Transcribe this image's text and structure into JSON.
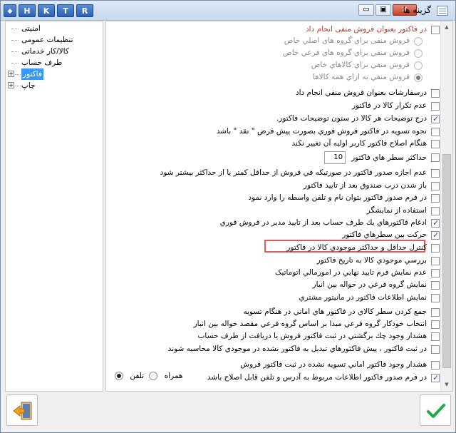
{
  "window": {
    "title": "گزینه ها",
    "hotkeys": [
      "H",
      "K",
      "T",
      "R"
    ],
    "menu_glyph": "◆",
    "controls": {
      "minimize": "▭",
      "restore": "▣",
      "close": "✕"
    }
  },
  "tree": {
    "items": [
      {
        "label": "امنیتی",
        "expandable": false,
        "selected": false
      },
      {
        "label": "تنظیمات عمومی",
        "expandable": false,
        "selected": false
      },
      {
        "label": "کالا/کار خدماتی",
        "expandable": false,
        "selected": false
      },
      {
        "label": "طرف حساب",
        "expandable": false,
        "selected": false
      },
      {
        "label": "فاکتور",
        "expandable": true,
        "selected": true
      },
      {
        "label": "چاپ",
        "expandable": true,
        "selected": false
      }
    ],
    "expand_glyph": "+"
  },
  "options": [
    {
      "type": "checkbox",
      "checked": false,
      "label": "در فاکتور بعنوان فروش منفی انجام داد",
      "red": true,
      "disabled": false,
      "sub": false
    },
    {
      "type": "radio",
      "checked": false,
      "label": "فروش منفی براي گروه هاي اصلي خاص",
      "disabled": true,
      "sub": true
    },
    {
      "type": "radio",
      "checked": false,
      "label": "فروش منفي براي گروه هاي فرعي خاص",
      "disabled": true,
      "sub": true
    },
    {
      "type": "radio",
      "checked": false,
      "label": "فروش منفي براي کالاهاي خاص",
      "disabled": true,
      "sub": true
    },
    {
      "type": "radio",
      "checked": true,
      "label": "فروش منفي به ازاي همه کالاها",
      "disabled": true,
      "sub": true
    },
    {
      "type": "checkbox",
      "checked": false,
      "label": "درسفارشات  بعنوان فروش منفي انجام داد",
      "disabled": false,
      "sub": false
    },
    {
      "type": "checkbox",
      "checked": false,
      "label": "عدم تکرار کالا در فاکتور",
      "disabled": false,
      "sub": false
    },
    {
      "type": "checkbox",
      "checked": true,
      "label": "درج توضيحات هر کالا در ستون توضيحات فاکتور.",
      "disabled": false,
      "sub": false
    },
    {
      "type": "checkbox",
      "checked": false,
      "label": "نحوه تسويه در فاکتور فروش فوري بصورت پيش فرض \" نقد \" باشد",
      "disabled": false,
      "sub": false
    },
    {
      "type": "checkbox",
      "checked": false,
      "label": "هنگام اصلاح فاکتور کاربر اوليه آن تغيير نکند",
      "disabled": false,
      "sub": false
    },
    {
      "type": "checkbox",
      "checked": false,
      "label": "حداکثر سطر هاي فاکتور",
      "disabled": false,
      "sub": false,
      "numbox": "10"
    },
    {
      "type": "checkbox",
      "checked": false,
      "label": "عدم اجازه صدور فاکتور در صورتيکه في فروش از حداقل کمتر يا از حداکثر بيشتر شود",
      "disabled": false,
      "sub": false
    },
    {
      "type": "checkbox",
      "checked": false,
      "label": "باز شدن درب صندوق بعد از تاييد فاکتور",
      "disabled": false,
      "sub": false
    },
    {
      "type": "checkbox",
      "checked": false,
      "label": "در فرم صدور فاکتور بتوان نام و تلفن واسطه را وارد نمود",
      "disabled": false,
      "sub": false
    },
    {
      "type": "checkbox",
      "checked": false,
      "label": "استفاده از نمايشگر",
      "disabled": false,
      "sub": false
    },
    {
      "type": "checkbox",
      "checked": true,
      "label": "ادغام فاکتورهاي يك طرف حساب بعد از تاييد مدير در فروش فوري",
      "disabled": false,
      "sub": false
    },
    {
      "type": "checkbox",
      "checked": true,
      "label": "حرکت بين سطرهاي فاکتور",
      "disabled": false,
      "sub": false
    },
    {
      "type": "checkbox",
      "checked": false,
      "label": "کنترل حداقل و حداکثر موجودي کالا در فاکتور",
      "disabled": false,
      "sub": false,
      "highlight": true
    },
    {
      "type": "checkbox",
      "checked": false,
      "label": "بررسي موجودي کالا به تاريخ فاکتور",
      "disabled": false,
      "sub": false
    },
    {
      "type": "checkbox",
      "checked": false,
      "label": "عدم نمايش فرم تاييد نهايي در امورمالي اتوماتيک",
      "disabled": false,
      "sub": false
    },
    {
      "type": "checkbox",
      "checked": false,
      "label": "نمايش گروه فرعي در حواله بين انبار",
      "disabled": false,
      "sub": false
    },
    {
      "type": "checkbox",
      "checked": false,
      "label": "نمايش اطلاعات فاکتور در مانيتور مشتري",
      "disabled": false,
      "sub": false
    },
    {
      "type": "checkbox",
      "checked": false,
      "label": "جمع کردن سطر کالاي در فاکتور هاي اماني در هنگام تسويه",
      "disabled": false,
      "sub": false
    },
    {
      "type": "checkbox",
      "checked": false,
      "label": "انتخاب خودکار گروه فرعي مبدا بر اساس گروه فرعي مقصد حواله بين انبار",
      "disabled": false,
      "sub": false
    },
    {
      "type": "checkbox",
      "checked": false,
      "label": "هشدار وجود چك برگشتي در ثبت فاکتور فروش يا دريافت از طرف حساب",
      "disabled": false,
      "sub": false
    },
    {
      "type": "checkbox",
      "checked": false,
      "label": "در ثبت فاکتور ، پيش فاکتورهاي تبديل به فاکتور نشده در موجودي کالا محاسبه شوند",
      "disabled": false,
      "sub": false
    },
    {
      "type": "checkbox",
      "checked": false,
      "label": "هشدار وجود فاکتور اماني تسويه نشده در ثبت فاکتور فروش",
      "disabled": false,
      "sub": false
    },
    {
      "type": "checkbox",
      "checked": true,
      "label": "در فرم صدور فاکتور اطلاعات مربوط به آدرس و تلفن قابل اصلاح باشد",
      "disabled": false,
      "sub": false
    }
  ],
  "phone_options": {
    "phone_label": "تلفن",
    "mobile_label": "همراه",
    "phone_selected": true,
    "mobile_selected": false
  },
  "scrollbar": {
    "up_glyph": "▲",
    "down_glyph": "▼"
  },
  "footer": {
    "exit_icon": "exit-door-icon",
    "ok_icon": "checkmark-icon"
  }
}
